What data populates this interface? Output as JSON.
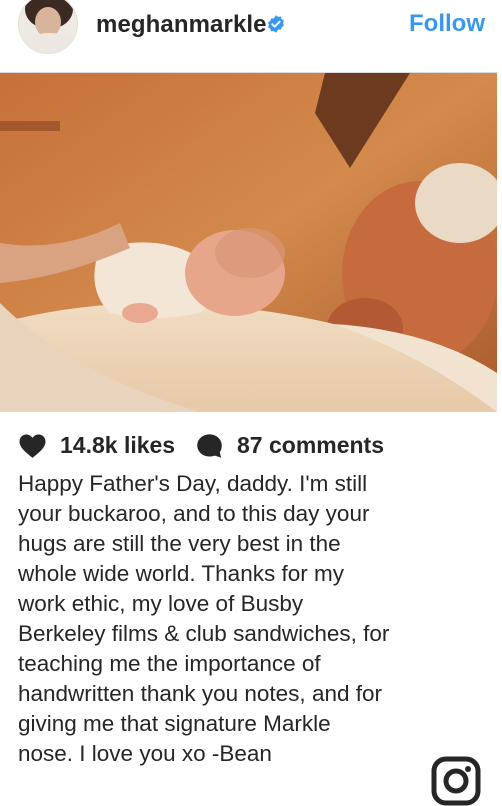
{
  "post": {
    "username": "meghanmarkle",
    "verified": true,
    "follow_label": "Follow",
    "likes_label": "14.8k likes",
    "comments_label": "87 comments",
    "caption_lines": [
      "Happy Father's Day, daddy. I'm still",
      "your buckaroo, and to this day your",
      "hugs are still the very best in the",
      "whole wide world. Thanks for my",
      "work ethic, my love of Busby",
      "Berkeley films & club sandwiches, for",
      "teaching me the importance of",
      "handwritten thank you notes, and for",
      "giving me that signature Markle",
      "nose. I love you xo -Bean"
    ]
  },
  "icons": {
    "verified": "verified-badge-icon",
    "like": "heart-icon",
    "comment": "comment-bubble-icon",
    "brand": "instagram-icon"
  },
  "colors": {
    "accent": "#3897f0",
    "text": "#262626",
    "border": "#dbdbdb"
  }
}
